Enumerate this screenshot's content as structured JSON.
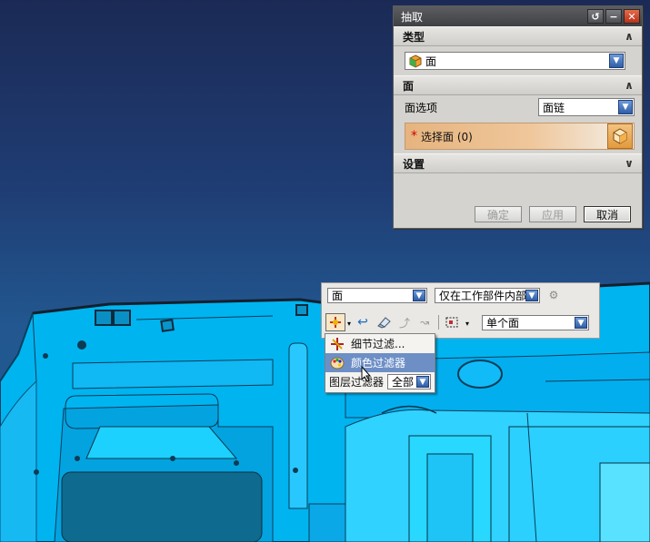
{
  "dialog": {
    "title": "抽取",
    "sections": {
      "type": {
        "label": "类型",
        "value": "面"
      },
      "face": {
        "label": "面",
        "option_label": "面选项",
        "option_value": "面链",
        "select_label": "选择面 (0)"
      },
      "settings": {
        "label": "设置"
      }
    },
    "buttons": {
      "ok": "确定",
      "apply": "应用",
      "cancel": "取消"
    }
  },
  "selection_bar": {
    "type_filter": "面",
    "scope_filter": "仅在工作部件内部",
    "face_rule": "单个面"
  },
  "filter_menu": {
    "items": [
      {
        "label": "细节过滤..."
      },
      {
        "label": "颜色过滤器"
      }
    ],
    "layer_filter_label": "图层过滤器",
    "layer_filter_value": "全部"
  },
  "colors": {
    "model_fill": "#00b4f0",
    "background_top": "#1b2a55",
    "background_bottom": "#1e5e93",
    "highlight": "#6d8fc6",
    "select_row": "#e6b47e"
  }
}
